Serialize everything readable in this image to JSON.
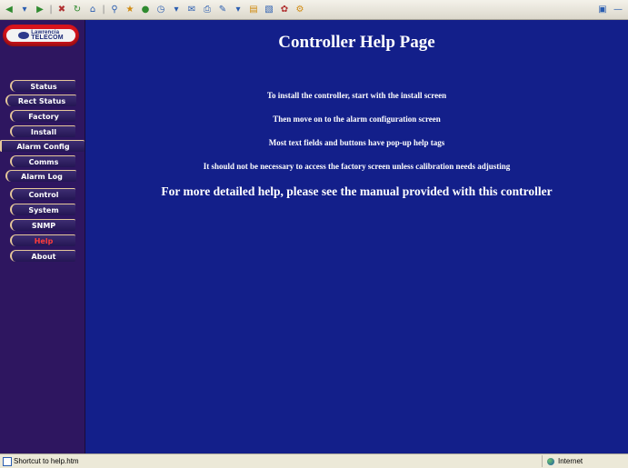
{
  "toolbar": {
    "icons": [
      "back-icon",
      "forward-icon",
      "stop-icon",
      "refresh-icon",
      "home-icon",
      "search-icon",
      "favorites-icon",
      "media-icon",
      "history-icon",
      "mail-icon",
      "print-icon",
      "edit-icon",
      "discuss-icon",
      "messenger-icon"
    ]
  },
  "logo": {
    "line1": "Lawrencia",
    "line2": "TELECOM"
  },
  "nav": {
    "items": [
      {
        "label": "Status"
      },
      {
        "label": "Rect Status"
      },
      {
        "label": "Factory"
      },
      {
        "label": "Install"
      },
      {
        "label": "Alarm Config"
      },
      {
        "label": "Comms"
      },
      {
        "label": "Alarm Log"
      },
      {
        "label": "Control"
      },
      {
        "label": "System"
      },
      {
        "label": "SNMP"
      },
      {
        "label": "Help"
      },
      {
        "label": "About"
      }
    ],
    "active": "Help"
  },
  "main": {
    "title": "Controller Help Page",
    "lines": [
      "To install the controller, start with the install screen",
      "Then move on to the alarm configuration screen",
      "Most text fields and buttons have pop-up help tags",
      "It should not be necessary to access the factory screen unless calibration needs adjusting",
      "For more detailed help, please see the manual provided with this controller"
    ]
  },
  "statusbar": {
    "text": "Shortcut to help.htm",
    "zone": "Internet"
  },
  "colors": {
    "main_bg": "#131f8a",
    "nav_bg": "#2e1660",
    "active_nav": "#ff3b3b"
  }
}
